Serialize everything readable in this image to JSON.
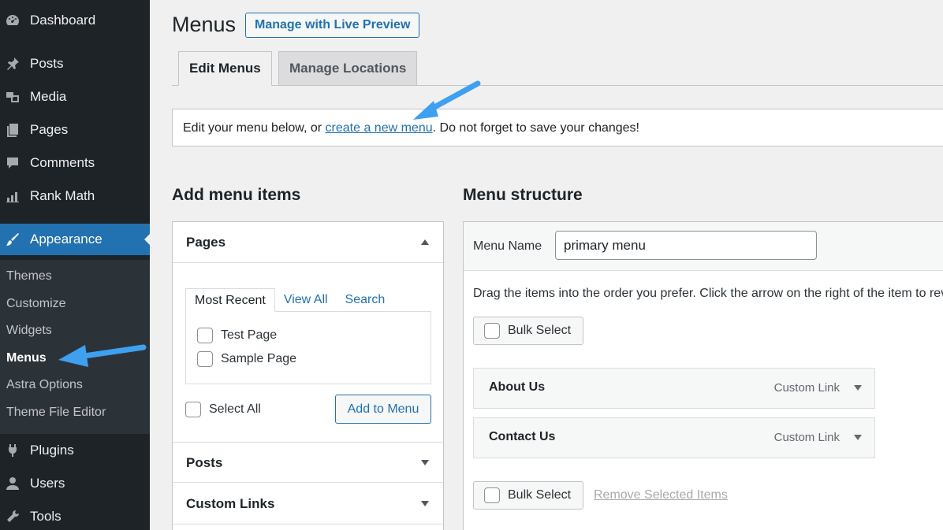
{
  "sidebar": {
    "items": [
      {
        "label": "Dashboard",
        "icon": "dashboard-icon"
      },
      {
        "label": "Posts",
        "icon": "pin-icon"
      },
      {
        "label": "Media",
        "icon": "media-icon"
      },
      {
        "label": "Pages",
        "icon": "pages-icon"
      },
      {
        "label": "Comments",
        "icon": "comments-icon"
      },
      {
        "label": "Rank Math",
        "icon": "chart-icon"
      },
      {
        "label": "Appearance",
        "icon": "brush-icon"
      },
      {
        "label": "Plugins",
        "icon": "plug-icon"
      },
      {
        "label": "Users",
        "icon": "user-icon"
      },
      {
        "label": "Tools",
        "icon": "wrench-icon"
      }
    ],
    "submenu": [
      "Themes",
      "Customize",
      "Widgets",
      "Menus",
      "Astra Options",
      "Theme File Editor"
    ]
  },
  "header": {
    "title": "Menus",
    "live_preview_label": "Manage with Live Preview"
  },
  "tabs": [
    "Edit Menus",
    "Manage Locations"
  ],
  "notice": {
    "before": "Edit your menu below, or ",
    "link": "create a new menu",
    "after": ". Do not forget to save your changes!"
  },
  "add_items": {
    "title": "Add menu items",
    "pages_label": "Pages",
    "mini_tabs": [
      "Most Recent",
      "View All",
      "Search"
    ],
    "pages": [
      "Test Page",
      "Sample Page"
    ],
    "select_all": "Select All",
    "add_button": "Add to Menu",
    "posts_label": "Posts",
    "custom_links_label": "Custom Links"
  },
  "structure": {
    "title": "Menu structure",
    "menu_name_label": "Menu Name",
    "menu_name_value": "primary menu",
    "drag_help": "Drag the items into the order you prefer. Click the arrow on the right of the item to reveal additional configuration options.",
    "bulk_select": "Bulk Select",
    "items": [
      {
        "title": "About Us",
        "type": "Custom Link"
      },
      {
        "title": "Contact Us",
        "type": "Custom Link"
      }
    ],
    "remove_selected": "Remove Selected Items"
  },
  "colors": {
    "accent": "#2271b1",
    "sidebar_bg": "#1d2327",
    "annotation_arrow": "#3fa0f0"
  }
}
